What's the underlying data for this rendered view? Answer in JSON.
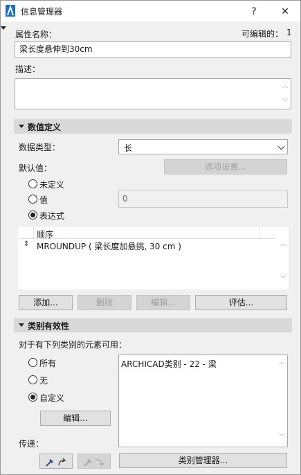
{
  "window": {
    "title": "信息管理器",
    "help_label": "?",
    "close_label": "✕"
  },
  "attribute": {
    "name_label": "属性名称：",
    "editable_label": "可编辑的：",
    "editable_value": "1",
    "name_value": "梁长度悬伸到30cm",
    "description_label": "描述："
  },
  "value_definition": {
    "section_title": "数值定义",
    "data_type_label": "数据类型：",
    "data_type_value": "长",
    "default_label": "默认值：",
    "options_button": "选项设置...",
    "radio_undefined": "未定义",
    "radio_value": "值",
    "value_field": "0",
    "radio_expression": "表达式",
    "table_header": "顺序",
    "expression_row": "MROUNDUP ( 梁长度加悬挑, 30 cm )",
    "row_handle": "⇕",
    "add_button": "添加...",
    "delete_button": "删除",
    "edit_button": "编辑...",
    "evaluate_button": "评估..."
  },
  "classification": {
    "section_title": "类别有效性",
    "available_label": "对于有下列类别的元素可用：",
    "radio_all": "所有",
    "radio_none": "无",
    "radio_custom": "自定义",
    "edit_button": "编辑...",
    "list_item": "ARCHICAD类别 - 22 - 梁",
    "transfer_label": "传递：",
    "manager_button": "类别管理器..."
  }
}
